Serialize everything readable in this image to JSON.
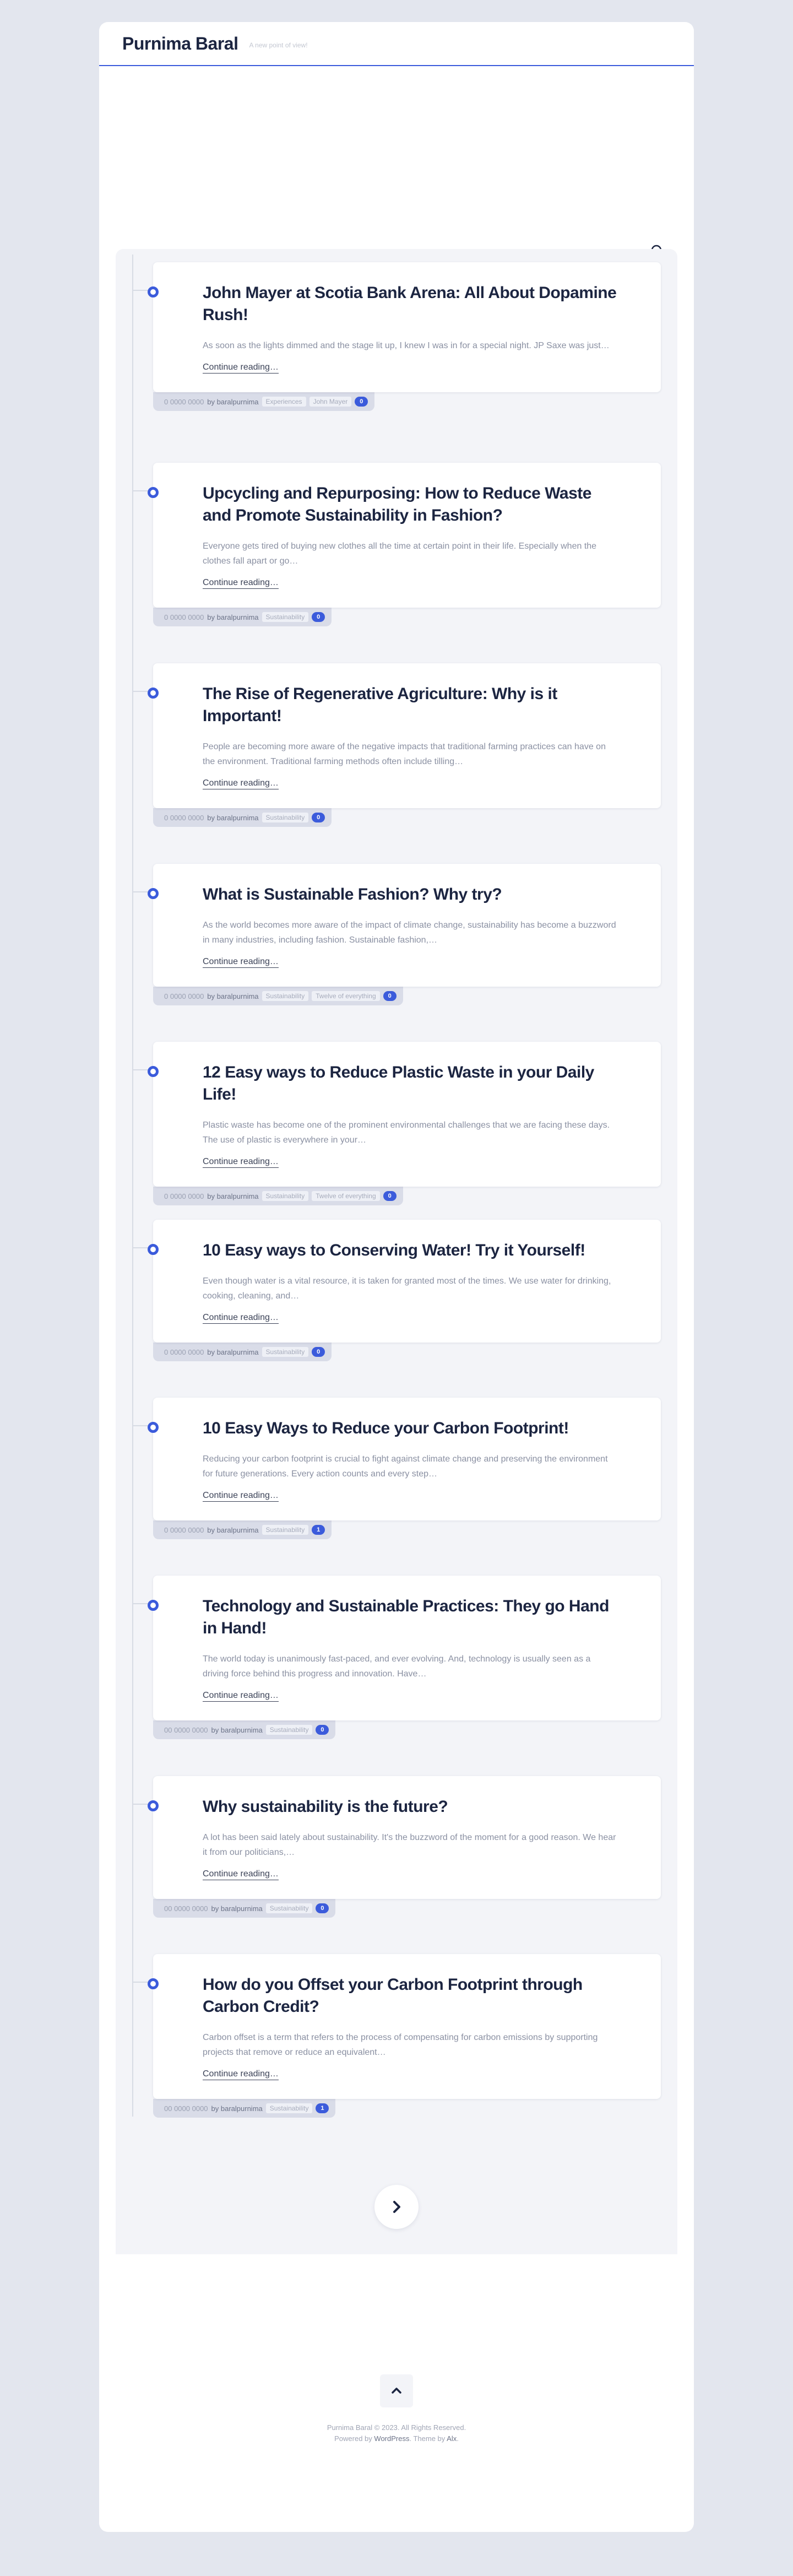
{
  "site": {
    "title": "Purnima Baral",
    "tagline": "A new point of view!"
  },
  "posts": [
    {
      "title": "John Mayer at Scotia Bank Arena: All About Dopamine Rush!",
      "excerpt": "As soon as the lights dimmed and the stage lit up, I knew I was in for a special night. JP Saxe was just…",
      "more": "Continue reading…",
      "date": "0 0000 0000",
      "author": "baralpurnima",
      "tags": [
        "Experiences",
        "John Mayer"
      ],
      "comments": "0"
    },
    {
      "title": "Upcycling and Repurposing: How to Reduce Waste and Promote Sustainability in Fashion?",
      "excerpt": "Everyone gets tired of buying new clothes all the time at certain point in their life. Especially when the clothes fall apart or go…",
      "more": "Continue reading…",
      "date": "0 0000 0000",
      "author": "baralpurnima",
      "tags": [
        "Sustainability"
      ],
      "comments": "0"
    },
    {
      "title": "The Rise of Regenerative Agriculture: Why is it Important!",
      "excerpt": "People are becoming more aware of the negative impacts that traditional farming practices can have on the environment. Traditional farming methods often include tilling…",
      "more": "Continue reading…",
      "date": "0 0000 0000",
      "author": "baralpurnima",
      "tags": [
        "Sustainability"
      ],
      "comments": "0"
    },
    {
      "title": "What is Sustainable Fashion? Why try?",
      "excerpt": "As the world becomes more aware of the impact of climate change, sustainability has become a buzzword in many industries, including fashion. Sustainable fashion,…",
      "more": "Continue reading…",
      "date": "0 0000 0000",
      "author": "baralpurnima",
      "tags": [
        "Sustainability",
        "Twelve of everything"
      ],
      "comments": "0"
    },
    {
      "title": "12 Easy ways to Reduce Plastic Waste in your Daily Life!",
      "excerpt": "Plastic waste has become one of the prominent environmental challenges that we are facing these days. The use of plastic is everywhere in your…",
      "more": "Continue reading…",
      "date": "0 0000 0000",
      "author": "baralpurnima",
      "tags": [
        "Sustainability",
        "Twelve of everything"
      ],
      "comments": "0"
    },
    {
      "title": "10 Easy ways to Conserving Water! Try it Yourself!",
      "excerpt": "Even though water is a vital resource, it is taken for granted most of the times. We use water for drinking, cooking, cleaning, and…",
      "more": "Continue reading…",
      "date": "0 0000 0000",
      "author": "baralpurnima",
      "tags": [
        "Sustainability"
      ],
      "comments": "0"
    },
    {
      "title": "10 Easy Ways to Reduce your Carbon Footprint!",
      "excerpt": "Reducing your carbon footprint is crucial to fight against climate change and preserving the environment for future generations. Every action counts and every step…",
      "more": "Continue reading…",
      "date": "0 0000 0000",
      "author": "baralpurnima",
      "tags": [
        "Sustainability"
      ],
      "comments": "1"
    },
    {
      "title": "Technology and Sustainable Practices: They go Hand in Hand!",
      "excerpt": "The world today is unanimously fast-paced, and ever evolving. And, technology is usually seen as a driving force behind this progress and innovation. Have…",
      "more": "Continue reading…",
      "date": "00 0000 0000",
      "author": "baralpurnima",
      "tags": [
        "Sustainability"
      ],
      "comments": "0"
    },
    {
      "title": "Why sustainability is the future?",
      "excerpt": "A lot has been said lately about sustainability. It's the buzzword of the moment for a good reason. We hear it from our politicians,…",
      "more": "Continue reading…",
      "date": "00 0000 0000",
      "author": "baralpurnima",
      "tags": [
        "Sustainability"
      ],
      "comments": "0"
    },
    {
      "title": "How do you Offset your Carbon Footprint through Carbon Credit?",
      "excerpt": "Carbon offset is a term that refers to the process of compensating for carbon emissions by supporting projects that remove or reduce an equivalent…",
      "more": "Continue reading…",
      "date": "00 0000 0000",
      "author": "baralpurnima",
      "tags": [
        "Sustainability"
      ],
      "comments": "1"
    }
  ],
  "footer": {
    "copyright": "Purnima Baral © 2023. All Rights Reserved.",
    "powered_prefix": "Powered by",
    "powered_link": "WordPress",
    "theme_prefix": ". Theme by",
    "theme_link": "Alx",
    "theme_suffix": "."
  },
  "icons": {
    "search": "search-icon",
    "next": "chevron-right-icon",
    "top": "chevron-up-icon"
  },
  "colors": {
    "accent": "#3b5bdb",
    "title": "#1c2541"
  }
}
